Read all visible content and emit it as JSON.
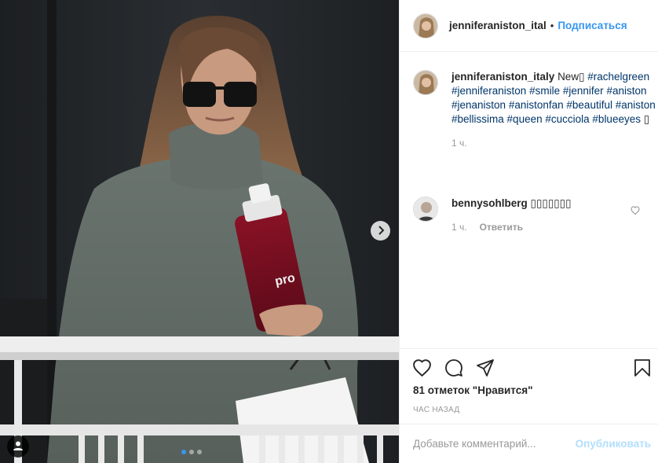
{
  "post": {
    "username": "jenniferaniston_ital",
    "follow_label": "Подписаться",
    "separator": "•"
  },
  "caption": {
    "username": "jenniferaniston_italy",
    "text": "New",
    "emoji_box": "▯",
    "hashtags": [
      "#rachelgreen",
      "#jenniferaniston",
      "#smile",
      "#jennifer",
      "#aniston",
      "#jenaniston",
      "#anistonfan",
      "#beautiful",
      "#aniston",
      "#bellissima",
      "#queen",
      "#cucciola",
      "#blueeyes"
    ],
    "trailing": "▯",
    "time": "1 ч."
  },
  "comments": [
    {
      "username": "bennysohlberg",
      "text": "▯▯▯▯▯▯▯",
      "time": "1 ч.",
      "reply_label": "Ответить"
    }
  ],
  "photo": {
    "bottle_text": "pro",
    "carousel_dots": 3,
    "active_dot": 0
  },
  "actions": {
    "likes_text": "81 отметок \"Нравится\"",
    "time_ago": "ЧАС НАЗАД"
  },
  "add_comment": {
    "placeholder": "Добавьте комментарий...",
    "publish_label": "Опубликовать"
  },
  "colors": {
    "link": "#3897f0",
    "hashtag": "#003569",
    "muted": "#999999",
    "publish_disabled": "#b2dffc"
  },
  "icons": {
    "next": "chevron-right-icon",
    "user_tags": "user-icon",
    "like": "heart-icon",
    "comment": "comment-icon",
    "share": "share-icon",
    "save": "bookmark-icon"
  }
}
